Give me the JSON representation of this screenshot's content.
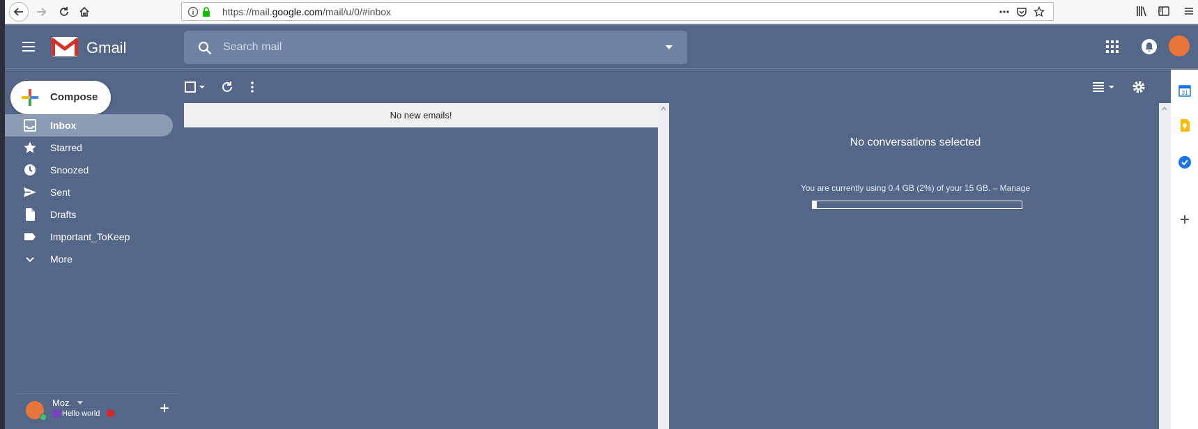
{
  "browser": {
    "url_prefix": "https://mail.",
    "url_domain": "google.com",
    "url_path": "/mail/u/0/#inbox"
  },
  "header": {
    "app_name": "Gmail",
    "search_placeholder": "Search mail"
  },
  "sidebar": {
    "compose_label": "Compose",
    "items": [
      {
        "label": "Inbox",
        "icon": "inbox-icon",
        "active": true
      },
      {
        "label": "Starred",
        "icon": "star-icon"
      },
      {
        "label": "Snoozed",
        "icon": "clock-icon"
      },
      {
        "label": "Sent",
        "icon": "send-icon"
      },
      {
        "label": "Drafts",
        "icon": "draft-icon"
      },
      {
        "label": "Important_ToKeep",
        "icon": "label-icon"
      },
      {
        "label": "More",
        "icon": "chevron-down-icon"
      }
    ]
  },
  "hangouts": {
    "name": "Moz",
    "status": "Hello world"
  },
  "list": {
    "empty_message": "No new emails!"
  },
  "preview": {
    "empty_title": "No conversations selected",
    "usage_text": "You are currently using 0.4 GB (2%) of your 15 GB. – Manage",
    "usage_percent": 2
  },
  "colors": {
    "theme_bg": "#546788",
    "active_item": "#8b9bb6",
    "search_bg": "#6e82a3"
  }
}
